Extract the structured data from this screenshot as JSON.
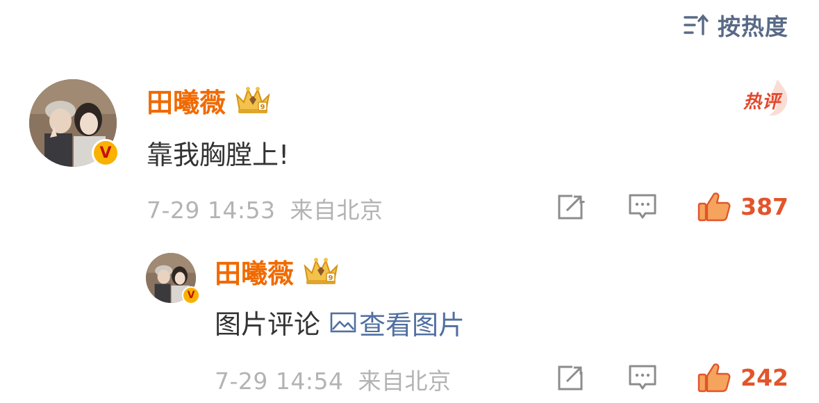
{
  "sort": {
    "label": "按热度",
    "icon": "sort-icon"
  },
  "comments": [
    {
      "author": "田曦薇",
      "text": "靠我胸膛上!",
      "time": "7-29 14:53",
      "location": "来自北京",
      "likes": "387",
      "hot_label": "热评",
      "verified": "V"
    }
  ],
  "replies": [
    {
      "author": "田曦薇",
      "text": "图片评论",
      "image_link": "查看图片",
      "time": "7-29 14:54",
      "location": "来自北京",
      "likes": "242",
      "verified": "V"
    }
  ],
  "colors": {
    "author": "#f06a00",
    "link": "#506fa0",
    "meta": "#b3b3b3",
    "like": "#e2542a",
    "hot": "#e2472c",
    "sort": "#596a87"
  }
}
